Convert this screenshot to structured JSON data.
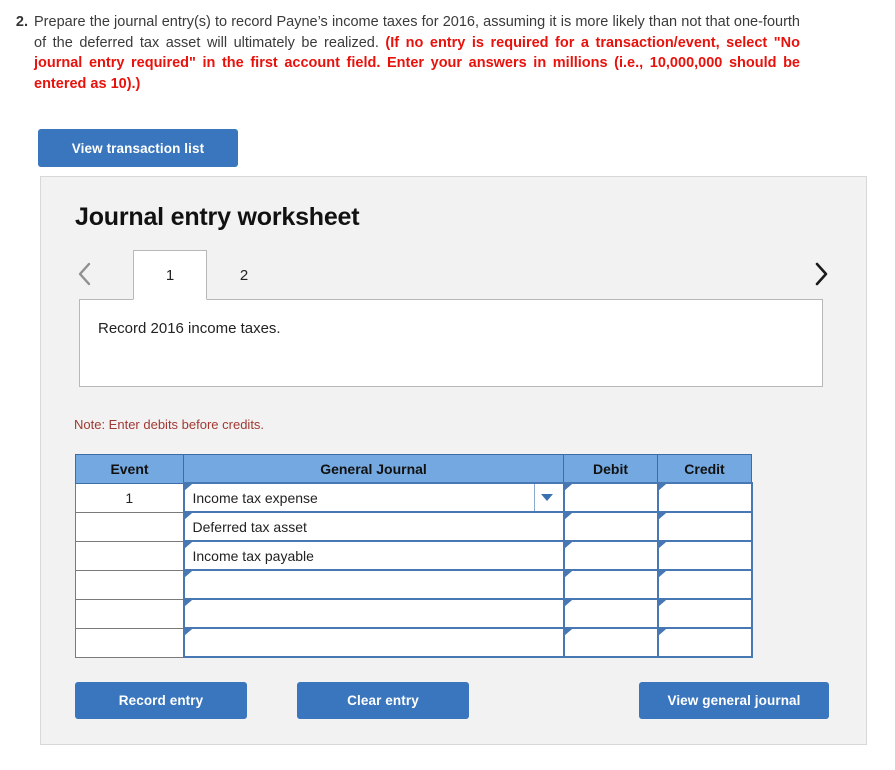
{
  "question": {
    "number": "2.",
    "text_plain": "Prepare the journal entry(s) to record Payne’s income taxes for 2016, assuming it is more likely than not that one-fourth of the deferred tax asset will ultimately be realized. ",
    "text_emphasis": "(If no entry is required for a transaction/event, select \"No journal entry required\" in the first account field. Enter your answers in millions (i.e., 10,000,000 should be entered as 10).)"
  },
  "toolbar": {
    "view_transaction_list_label": "View transaction list"
  },
  "panel": {
    "title": "Journal entry worksheet",
    "prev_icon": "chevron-left-icon",
    "next_icon": "chevron-right-icon",
    "tabs": [
      {
        "label": "1",
        "active": true
      },
      {
        "label": "2",
        "active": false
      }
    ],
    "description": "Record 2016 income taxes.",
    "note": "Note: Enter debits before credits."
  },
  "table": {
    "headers": [
      "Event",
      "General Journal",
      "Debit",
      "Credit"
    ],
    "rows": [
      {
        "event": "1",
        "account": "Income tax expense",
        "debit": "",
        "credit": "",
        "has_dropdown": true
      },
      {
        "event": "",
        "account": "Deferred tax asset",
        "debit": "",
        "credit": "",
        "has_dropdown": false
      },
      {
        "event": "",
        "account": "Income tax payable",
        "debit": "",
        "credit": "",
        "has_dropdown": false
      },
      {
        "event": "",
        "account": "",
        "debit": "",
        "credit": "",
        "has_dropdown": false
      },
      {
        "event": "",
        "account": "",
        "debit": "",
        "credit": "",
        "has_dropdown": false
      },
      {
        "event": "",
        "account": "",
        "debit": "",
        "credit": "",
        "has_dropdown": false
      }
    ]
  },
  "footer": {
    "record_entry_label": "Record entry",
    "clear_entry_label": "Clear entry",
    "view_general_journal_label": "View general journal"
  },
  "colors": {
    "button_blue": "#3a76bd",
    "table_header_blue": "#73a8e0",
    "input_border_blue": "#4878b4",
    "emphasis_red": "#e8120c",
    "note_red": "#a03a33",
    "panel_bg": "#f2f2f2"
  }
}
